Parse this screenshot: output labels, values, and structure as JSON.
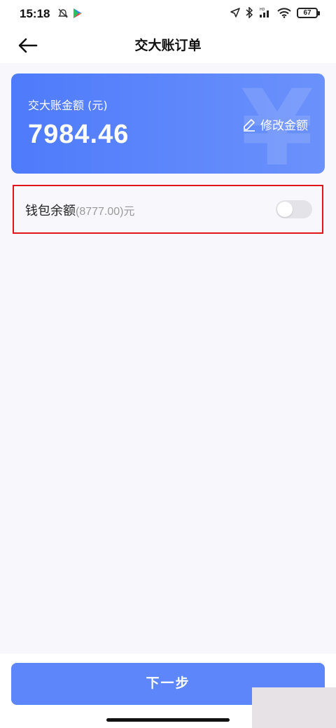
{
  "status_bar": {
    "time": "15:18",
    "battery": "67",
    "left_icons": [
      "mute-alarm-icon",
      "play-store-icon"
    ],
    "right_icons": [
      "location-icon",
      "bluetooth-icon",
      "signal-hd-icon",
      "wifi-icon",
      "battery-icon"
    ]
  },
  "nav": {
    "title": "交大账订单",
    "back_icon": "back-arrow-icon"
  },
  "amount_card": {
    "label": "交大账金额 (元)",
    "amount": "7984.46",
    "modify_label": "修改金额",
    "watermark": "¥",
    "gradient_start": "#4e7bfb",
    "gradient_end": "#6b91fb"
  },
  "wallet": {
    "label": "钱包余额",
    "balance": "(8777.00)",
    "unit": "元",
    "toggle_on": false,
    "highlight_color": "#e0161c"
  },
  "footer": {
    "next_label": "下一步",
    "button_color": "#5c86f9"
  }
}
